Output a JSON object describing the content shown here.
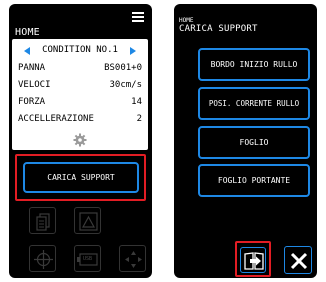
{
  "home_screen": {
    "title": "HOME",
    "condition": {
      "title": "CONDITION NO.1",
      "rows": [
        {
          "label": "PANNA",
          "value": "BS001+0"
        },
        {
          "label": "VELOCI",
          "value": "30cm/s"
        },
        {
          "label": "FORZA",
          "value": "14"
        },
        {
          "label": "ACCELLERAZIONE",
          "value": "2"
        }
      ]
    },
    "load_button_label": "CARICA SUPPORT",
    "usb_label": "USB"
  },
  "support_screen": {
    "breadcrumb": "HOME",
    "title": "CARICA SUPPORT",
    "options": [
      "BORDO INIZIO RULLO",
      "POSI. CORRENTE RULLO",
      "FOGLIO",
      "FOGLIO PORTANTE"
    ]
  },
  "colors": {
    "accent": "#1e88e5",
    "highlight": "#e31d24",
    "screen_bg": "#000000",
    "panel_bg": "#ffffff"
  },
  "icons": [
    "menu-icon",
    "gear-icon",
    "page-icon",
    "triangle-icon",
    "crosshair-icon",
    "usb-icon",
    "move-arrows-icon",
    "book-arrow-icon",
    "close-icon"
  ]
}
